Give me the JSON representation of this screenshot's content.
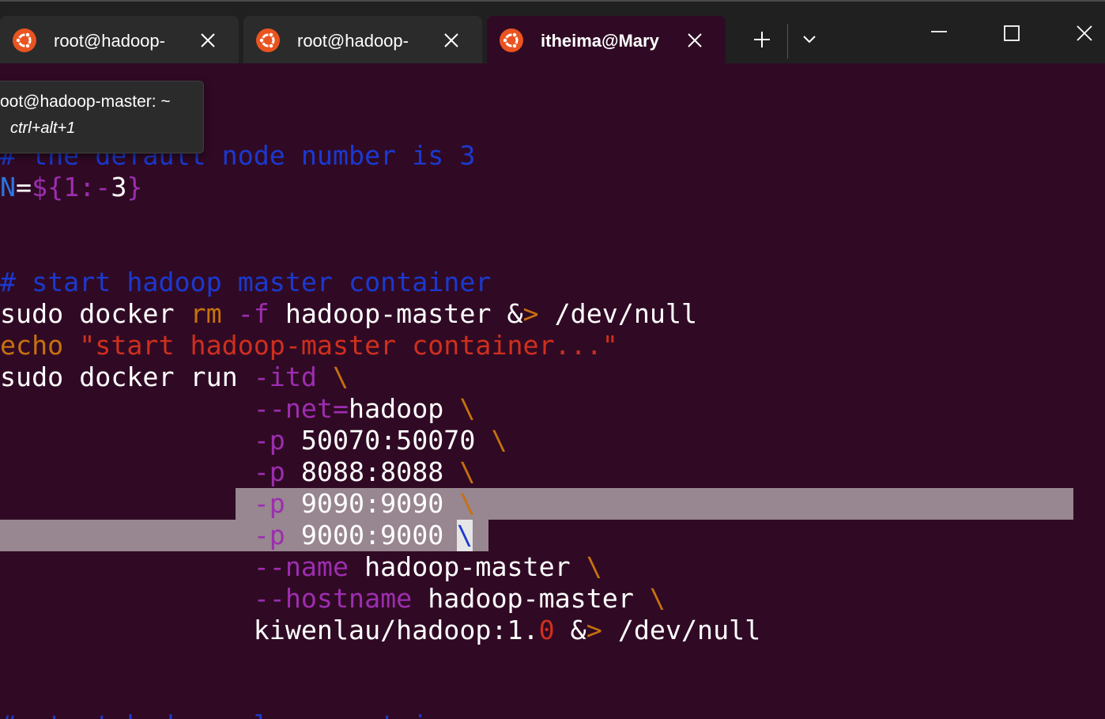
{
  "window": {
    "tabs": [
      {
        "label": "root@hadoop-",
        "active": false
      },
      {
        "label": "root@hadoop-",
        "active": false
      },
      {
        "label": "itheima@Mary",
        "active": true
      }
    ],
    "icons": {
      "tab_icon": "ubuntu-icon",
      "close": "close-icon",
      "new_tab": "plus-icon",
      "dropdown": "chevron-down-icon",
      "minimize": "minimize-icon",
      "maximize": "maximize-icon",
      "window_close": "close-icon"
    }
  },
  "tooltip": {
    "title": "root@hadoop-master: ~",
    "shortcut": "ctrl+alt+1"
  },
  "colors": {
    "terminal_bg": "#300a24",
    "comment": "#1b39d0",
    "variable": "#2a75e0",
    "flag": "#9d2db0",
    "keyword": "#c7710e",
    "string": "#cf2f1d",
    "selection": "#988690"
  },
  "terminal": {
    "lines": [
      {
        "segs": [
          {
            "t": "# the default node number is 3",
            "c": "c-cmt"
          }
        ]
      },
      {
        "segs": [
          {
            "t": "N",
            "c": "c-var"
          },
          {
            "t": "=",
            "c": "c-wht"
          },
          {
            "t": "${1:-",
            "c": "c-pur"
          },
          {
            "t": "3",
            "c": "c-wht"
          },
          {
            "t": "}",
            "c": "c-pur"
          }
        ]
      },
      {
        "segs": []
      },
      {
        "segs": []
      },
      {
        "segs": [
          {
            "t": "# start hadoop master container",
            "c": "c-cmt"
          }
        ]
      },
      {
        "segs": [
          {
            "t": "sudo docker ",
            "c": "c-wht"
          },
          {
            "t": "rm",
            "c": "c-org"
          },
          {
            "t": " ",
            "c": "c-wht"
          },
          {
            "t": "-f",
            "c": "c-pur"
          },
          {
            "t": " hadoop-master &",
            "c": "c-wht"
          },
          {
            "t": ">",
            "c": "c-org"
          },
          {
            "t": " /dev/null",
            "c": "c-wht"
          }
        ]
      },
      {
        "segs": [
          {
            "t": "echo",
            "c": "c-org"
          },
          {
            "t": " \"start hadoop-master container...\"",
            "c": "c-red"
          }
        ]
      },
      {
        "segs": [
          {
            "t": "sudo docker run ",
            "c": "c-wht"
          },
          {
            "t": "-itd",
            "c": "c-pur"
          },
          {
            "t": " \\",
            "c": "c-org"
          }
        ]
      },
      {
        "segs": [
          {
            "t": "                ",
            "c": "c-wht"
          },
          {
            "t": "--net=",
            "c": "c-pur"
          },
          {
            "t": "hadoop",
            "c": "c-wht"
          },
          {
            "t": " \\",
            "c": "c-org"
          }
        ]
      },
      {
        "segs": [
          {
            "t": "                ",
            "c": "c-wht"
          },
          {
            "t": "-p",
            "c": "c-pur"
          },
          {
            "t": " 50070:50070",
            "c": "c-wht"
          },
          {
            "t": " \\",
            "c": "c-org"
          }
        ]
      },
      {
        "segs": [
          {
            "t": "                ",
            "c": "c-wht"
          },
          {
            "t": "-p",
            "c": "c-pur"
          },
          {
            "t": " 8088:8088",
            "c": "c-wht"
          },
          {
            "t": " \\",
            "c": "c-org"
          }
        ]
      },
      {
        "segs": [
          {
            "t": "                ",
            "c": "c-wht"
          },
          {
            "t": "-p",
            "c": "c-pur"
          },
          {
            "t": " 9090:9090",
            "c": "c-wht"
          },
          {
            "t": " \\",
            "c": "c-org"
          }
        ]
      },
      {
        "segs": [
          {
            "t": "                ",
            "c": "c-wht"
          },
          {
            "t": "-p",
            "c": "c-pur"
          },
          {
            "t": " 9000:9000 ",
            "c": "c-wht"
          }
        ]
      },
      {
        "segs": [
          {
            "t": "                ",
            "c": "c-wht"
          },
          {
            "t": "--name",
            "c": "c-pur"
          },
          {
            "t": " hadoop-master",
            "c": "c-wht"
          },
          {
            "t": " \\",
            "c": "c-org"
          }
        ]
      },
      {
        "segs": [
          {
            "t": "                ",
            "c": "c-wht"
          },
          {
            "t": "--hostname",
            "c": "c-pur"
          },
          {
            "t": " hadoop-master",
            "c": "c-wht"
          },
          {
            "t": " \\",
            "c": "c-org"
          }
        ]
      },
      {
        "segs": [
          {
            "t": "                kiwenlau/hadoop:1.",
            "c": "c-wht"
          },
          {
            "t": "0",
            "c": "c-red"
          },
          {
            "t": " &",
            "c": "c-wht"
          },
          {
            "t": ">",
            "c": "c-org"
          },
          {
            "t": " /dev/null",
            "c": "c-wht"
          }
        ]
      },
      {
        "segs": []
      },
      {
        "segs": []
      },
      {
        "segs": [
          {
            "t": "# start hadoop slave container",
            "c": "c-cmt"
          }
        ]
      }
    ],
    "cursor_char": "\\"
  }
}
